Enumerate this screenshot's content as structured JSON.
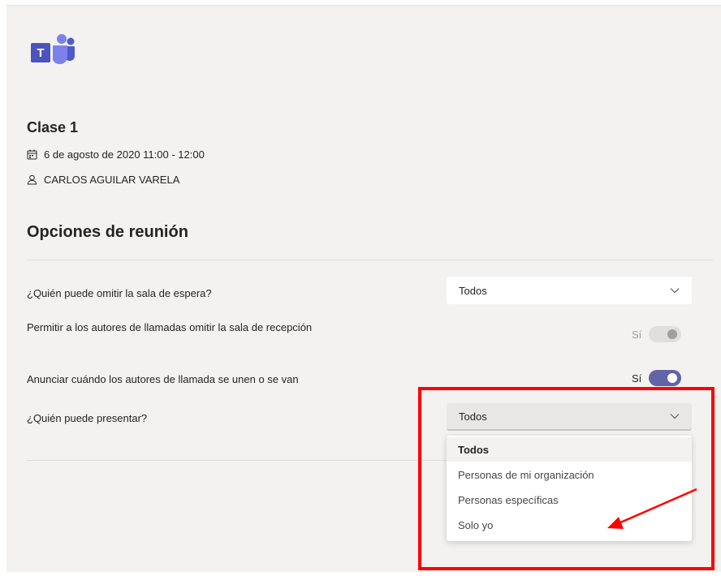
{
  "app": {
    "name": "Microsoft Teams",
    "logo_icon": "teams-logo-icon",
    "logo_letter": "T"
  },
  "meeting": {
    "title": "Clase 1",
    "datetime": "6 de agosto de 2020 11:00 - 12:00",
    "organizer": "CARLOS AGUILAR VARELA"
  },
  "section": {
    "title": "Opciones de reunión"
  },
  "options": {
    "bypass_lobby": {
      "label": "¿Quién puede omitir la sala de espera?",
      "value": "Todos"
    },
    "callers_bypass": {
      "label": "Permitir a los autores de llamadas omitir la sala de recepción",
      "state_label": "Sí",
      "enabled": true,
      "disabled": true
    },
    "announce": {
      "label": "Anunciar cuándo los autores de llamada se unen o se van",
      "state_label": "Sí",
      "enabled": true
    },
    "presenters": {
      "label": "¿Quién puede presentar?",
      "value": "Todos",
      "dropdown": [
        "Todos",
        "Personas de mi organización",
        "Personas específicas",
        "Solo yo"
      ],
      "selected_index": 0
    }
  },
  "colors": {
    "accent": "#6264a7",
    "annotation": "#ff0000",
    "background": "#f3f2f1"
  }
}
